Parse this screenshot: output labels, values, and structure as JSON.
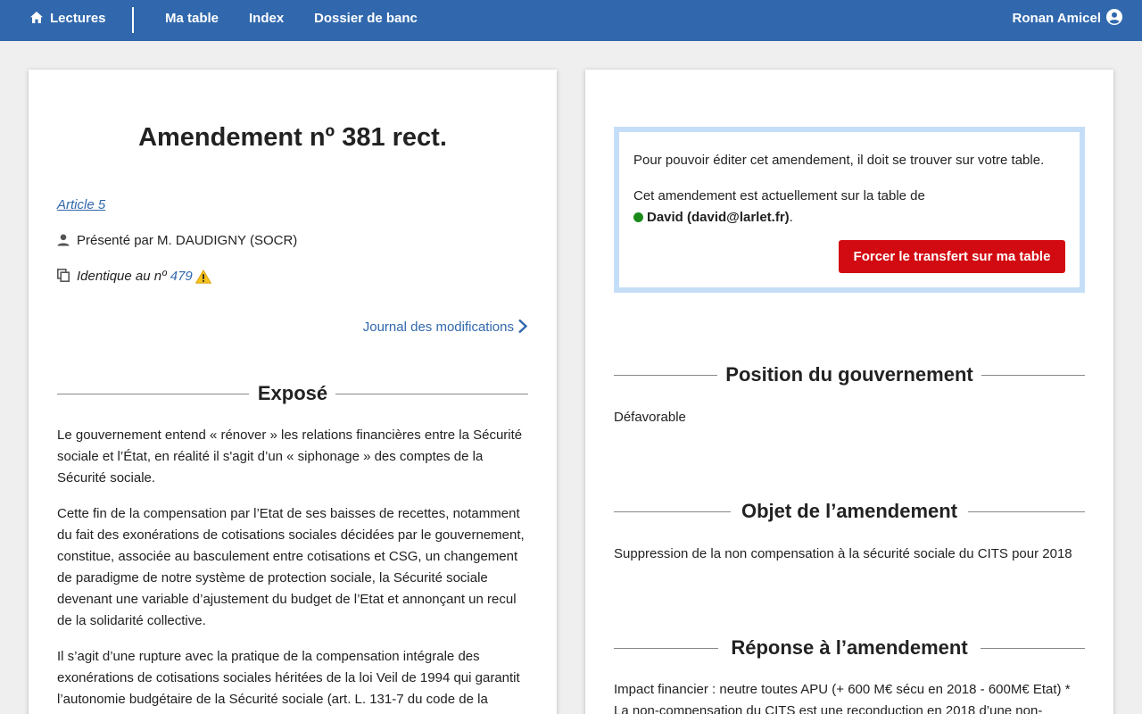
{
  "nav": {
    "home_label": "Lectures",
    "items": [
      "Ma table",
      "Index",
      "Dossier de banc"
    ],
    "user_name": "Ronan Amicel"
  },
  "amendment": {
    "title": "Amendement nº 381 rect.",
    "article_link": "Article 5",
    "author": "Présenté par M. DAUDIGNY (SOCR)",
    "identical_prefix": "Identique au nº",
    "identical_number": "479",
    "journal_link": "Journal des modifications"
  },
  "expose": {
    "heading": "Exposé",
    "paragraphs": [
      "Le gouvernement entend « rénover » les relations financières entre la Sécurité sociale et l’État, en réalité il s'agit d’un « siphonage » des comptes de la Sécurité sociale.",
      "Cette fin de la compensation par l’Etat de ses baisses de recettes, notamment du fait des exonérations de cotisations sociales décidées par le gouvernement, constitue, associée au basculement entre cotisations et CSG, un changement de paradigme de notre système de protection sociale, la Sécurité sociale devenant une variable d’ajustement du budget de l’Etat et annonçant un recul de la solidarité collective.",
      "Il s’agit d’une rupture avec la pratique de la compensation intégrale des exonérations de cotisations sociales héritées de la loi Veil de 1994 qui garantit l’autonomie budgétaire de la Sécurité sociale (art. L. 131-7 du code de la"
    ]
  },
  "notice": {
    "line1": "Pour pouvoir éditer cet amendement, il doit se trouver sur votre table.",
    "line2": "Cet amendement est actuellement sur la table de",
    "owner": "David (david@larlet.fr)",
    "owner_suffix": ".",
    "force_button": "Forcer le transfert sur ma table"
  },
  "position": {
    "heading": "Position du gouvernement",
    "text": "Défavorable"
  },
  "objet": {
    "heading": "Objet de l’amendement",
    "text": "Suppression de la non compensation à la sécurité sociale du CITS pour 2018"
  },
  "reponse": {
    "heading": "Réponse à l’amendement",
    "text": "Impact financier : neutre toutes APU (+ 600 M€ sécu en 2018 - 600M€ Etat) * La non-compensation du CITS est une reconduction en 2018 d’une non-"
  },
  "colors": {
    "nav_bg": "#3168ad",
    "link": "#3168ad",
    "danger_button": "#d20a11",
    "notice_border": "#c5def8",
    "online_dot": "#1a8a1a"
  }
}
